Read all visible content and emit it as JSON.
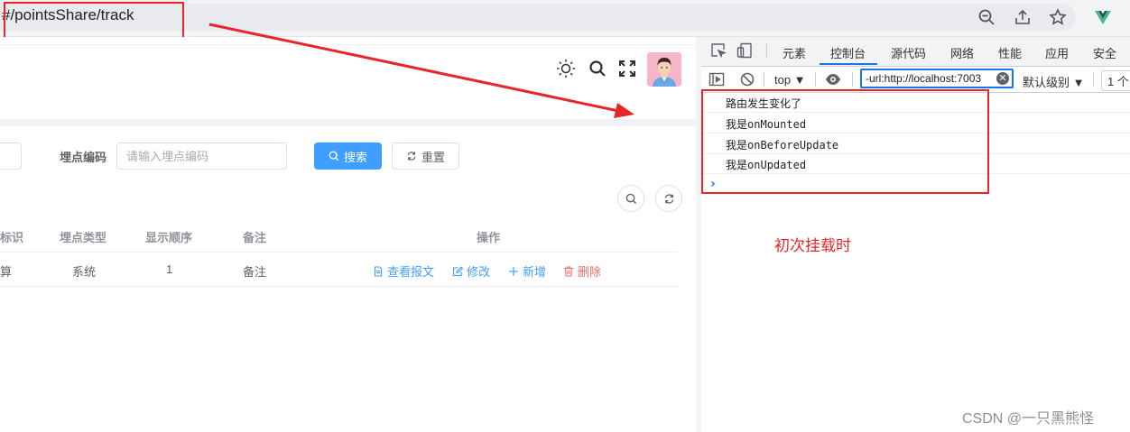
{
  "browser": {
    "url": "#/pointsShare/track",
    "icon_names": [
      "zoom-icon",
      "share-icon",
      "star-icon",
      "vue-devtools-icon"
    ]
  },
  "app": {
    "header_icons": [
      "theme-sun-icon",
      "search-icon",
      "fullscreen-icon",
      "avatar"
    ],
    "filter": {
      "code_label": "埋点编码",
      "code_placeholder": "请输入埋点编码",
      "search_label": "搜索",
      "reset_label": "重置"
    },
    "table": {
      "headers": {
        "identifier": "标识",
        "type": "埋点类型",
        "order": "显示顺序",
        "remark": "备注",
        "actions": "操作"
      },
      "row": {
        "identifier": "算",
        "type": "系统",
        "order": "1",
        "remark": "备注"
      },
      "actions": {
        "view": "查看报文",
        "edit": "修改",
        "add": "新增",
        "delete": "删除"
      }
    },
    "colors": {
      "primary": "#409eff",
      "danger": "#f56c6c"
    }
  },
  "devtools": {
    "tabs": [
      "元素",
      "控制台",
      "源代码",
      "网络",
      "性能",
      "应用",
      "安全"
    ],
    "active_tab": "控制台",
    "toolbar": {
      "context": "top ▼",
      "filter_value": "-url:http://localhost:7003",
      "level": "默认级别 ▼",
      "issues": "1 个"
    },
    "console": [
      {
        "prefix": "路由发生变化了",
        "code": ""
      },
      {
        "prefix": "我是",
        "code": "onMounted"
      },
      {
        "prefix": "我是",
        "code": "onBeforeUpdate"
      },
      {
        "prefix": "我是",
        "code": "onUpdated"
      }
    ]
  },
  "annotation": {
    "text": "初次挂载时",
    "color": "#e8262a"
  },
  "watermark": "CSDN @一只黑熊怪"
}
